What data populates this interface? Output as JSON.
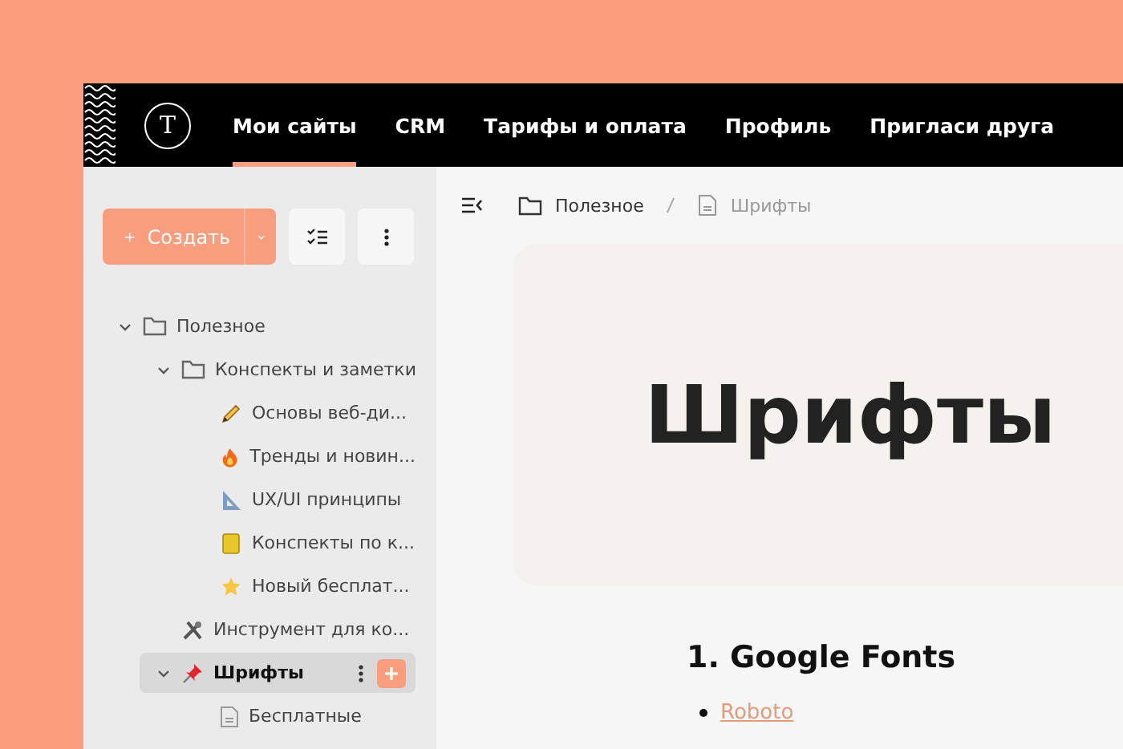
{
  "logo": {
    "letter": "T"
  },
  "nav": [
    {
      "label": "Мои сайты",
      "selected": true
    },
    {
      "label": "CRM",
      "selected": false
    },
    {
      "label": "Тарифы и оплата",
      "selected": false
    },
    {
      "label": "Профиль",
      "selected": false
    },
    {
      "label": "Пригласи друга",
      "selected": false
    }
  ],
  "sidebar": {
    "create_button": "Создать",
    "tree": [
      {
        "label": "Полезное",
        "kind": "folder",
        "expanded": true,
        "selected": false,
        "children": [
          {
            "label": "Конспекты и заметки",
            "kind": "folder",
            "expanded": true,
            "selected": false,
            "children": [
              {
                "label": "Основы веб-ди...",
                "kind": "pencil",
                "selected": false
              },
              {
                "label": "Тренды и новин...",
                "kind": "fire",
                "selected": false
              },
              {
                "label": "UX/UI принципы",
                "kind": "ruler",
                "selected": false
              },
              {
                "label": "Конспекты по к...",
                "kind": "notebook",
                "selected": false
              },
              {
                "label": "Новый бесплат...",
                "kind": "star",
                "selected": false
              }
            ]
          },
          {
            "label": "Инструмент для ко...",
            "kind": "tools",
            "selected": false
          },
          {
            "label": "Шрифты",
            "kind": "pin",
            "expanded": true,
            "selected": true,
            "children": [
              {
                "label": "Бесплатные",
                "kind": "page",
                "selected": false
              }
            ]
          }
        ]
      }
    ]
  },
  "breadcrumb": [
    {
      "label": "Полезное",
      "kind": "folder"
    },
    {
      "label": "Шрифты",
      "kind": "page"
    }
  ],
  "page": {
    "title": "Шрифты",
    "sections": [
      {
        "heading": "1. Google Fonts",
        "links": [
          "Roboto"
        ]
      }
    ]
  }
}
